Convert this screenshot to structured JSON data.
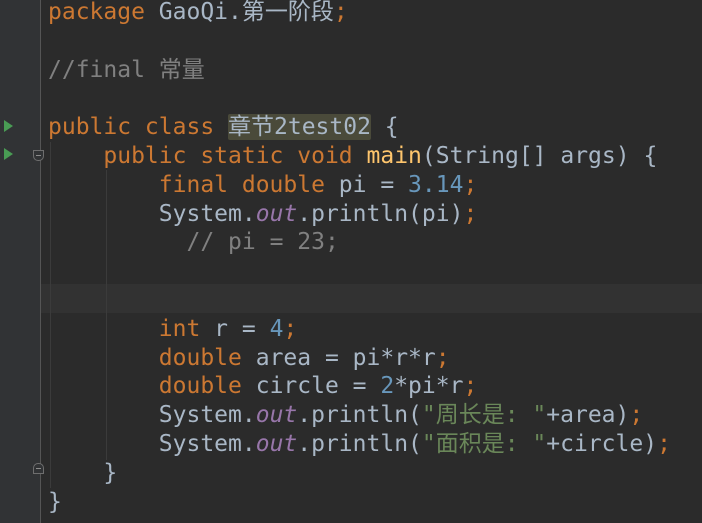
{
  "editor": {
    "lines": [
      {
        "tokens": [
          {
            "t": "package",
            "k": "kw"
          },
          {
            "t": " GaoQi.第一阶段",
            "k": "id"
          },
          {
            "t": ";",
            "k": "punc"
          }
        ]
      },
      {
        "tokens": []
      },
      {
        "tokens": [
          {
            "t": "//final 常量",
            "k": "cmt"
          }
        ]
      },
      {
        "tokens": []
      },
      {
        "tokens": [
          {
            "t": "public class ",
            "k": "kw"
          },
          {
            "t": "章节2test02",
            "k": "cls-hl"
          },
          {
            "t": " {",
            "k": "id"
          }
        ]
      },
      {
        "tokens": [
          {
            "t": "    "
          },
          {
            "t": "public static void ",
            "k": "kw"
          },
          {
            "t": "main",
            "k": "fn"
          },
          {
            "t": "(String[] args) {",
            "k": "id"
          }
        ]
      },
      {
        "tokens": [
          {
            "t": "        "
          },
          {
            "t": "final double ",
            "k": "kw"
          },
          {
            "t": "pi = ",
            "k": "id"
          },
          {
            "t": "3.14",
            "k": "num"
          },
          {
            "t": ";",
            "k": "punc"
          }
        ]
      },
      {
        "tokens": [
          {
            "t": "        "
          },
          {
            "t": "System.",
            "k": "id"
          },
          {
            "t": "out",
            "k": "fld"
          },
          {
            "t": ".println(pi)",
            "k": "id"
          },
          {
            "t": ";",
            "k": "punc"
          }
        ]
      },
      {
        "tokens": [
          {
            "t": "          "
          },
          {
            "t": "// pi = 23;",
            "k": "cmt"
          }
        ]
      },
      {
        "tokens": []
      },
      {
        "tokens": []
      },
      {
        "tokens": [
          {
            "t": "        "
          },
          {
            "t": "int ",
            "k": "kw"
          },
          {
            "t": "r = ",
            "k": "id"
          },
          {
            "t": "4",
            "k": "num"
          },
          {
            "t": ";",
            "k": "punc"
          }
        ]
      },
      {
        "tokens": [
          {
            "t": "        "
          },
          {
            "t": "double ",
            "k": "kw"
          },
          {
            "t": "area = pi*r*r",
            "k": "id"
          },
          {
            "t": ";",
            "k": "punc"
          }
        ]
      },
      {
        "tokens": [
          {
            "t": "        "
          },
          {
            "t": "double ",
            "k": "kw"
          },
          {
            "t": "circle = ",
            "k": "id"
          },
          {
            "t": "2",
            "k": "num"
          },
          {
            "t": "*pi*r",
            "k": "id"
          },
          {
            "t": ";",
            "k": "punc"
          }
        ]
      },
      {
        "tokens": [
          {
            "t": "        "
          },
          {
            "t": "System.",
            "k": "id"
          },
          {
            "t": "out",
            "k": "fld"
          },
          {
            "t": ".println(",
            "k": "id"
          },
          {
            "t": "\"周长是: \"",
            "k": "str"
          },
          {
            "t": "+area)",
            "k": "id"
          },
          {
            "t": ";",
            "k": "punc"
          }
        ]
      },
      {
        "tokens": [
          {
            "t": "        "
          },
          {
            "t": "System.",
            "k": "id"
          },
          {
            "t": "out",
            "k": "fld"
          },
          {
            "t": ".println(",
            "k": "id"
          },
          {
            "t": "\"面积是: \"",
            "k": "str"
          },
          {
            "t": "+circle)",
            "k": "id"
          },
          {
            "t": ";",
            "k": "punc"
          }
        ]
      },
      {
        "tokens": [
          {
            "t": "    "
          },
          {
            "t": "}",
            "k": "id"
          }
        ]
      },
      {
        "tokens": [
          {
            "t": "}",
            "k": "id"
          }
        ]
      }
    ],
    "colors": {
      "background": "#2b2b2b",
      "gutter": "#313335",
      "keyword": "#cc7832",
      "identifier": "#a9b7c6",
      "number": "#6897bb",
      "comment": "#808080",
      "method": "#ffc66d",
      "field": "#9876aa",
      "string": "#6a8759",
      "run_marker": "#499c54"
    },
    "gutter_icons": [
      {
        "name": "run-class-icon",
        "line": 4
      },
      {
        "name": "run-main-icon",
        "line": 5
      },
      {
        "name": "fold-main-icon",
        "line": 5
      },
      {
        "name": "fold-end-icon",
        "line": 16
      }
    ]
  }
}
